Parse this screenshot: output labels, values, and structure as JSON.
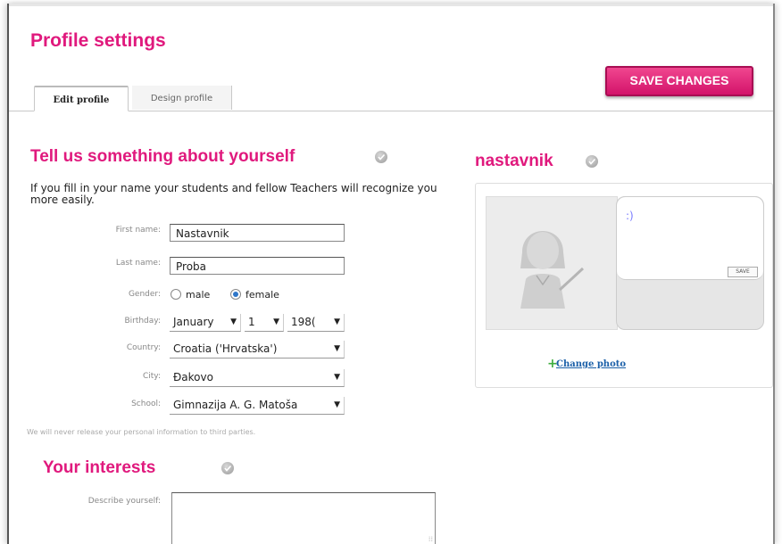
{
  "page": {
    "title": "Profile settings",
    "save_label": "SAVE CHANGES"
  },
  "tabs": [
    {
      "label": "Edit profile",
      "active": true
    },
    {
      "label": "Design profile",
      "active": false
    }
  ],
  "about": {
    "heading": "Tell us something about yourself",
    "intro": "If you fill in your name your students and fellow Teachers will recognize you more easily.",
    "first_name": {
      "label": "First name:",
      "value": "Nastavnik"
    },
    "last_name": {
      "label": "Last name:",
      "value": "Proba"
    },
    "gender": {
      "label": "Gender:",
      "options": [
        "male",
        "female"
      ],
      "selected": "female"
    },
    "birthday": {
      "label": "Birthday:",
      "month": "January",
      "day": "1",
      "year": "198("
    },
    "country": {
      "label": "Country:",
      "value": "Croatia ('Hrvatska')"
    },
    "city": {
      "label": "City:",
      "value": "Đakovo"
    },
    "school": {
      "label": "School:",
      "value": "Gimnazija A. G. Matoša"
    },
    "privacy_note": "We will never release your personal information to third parties."
  },
  "interests": {
    "heading": "Your interests",
    "describe_label": "Describe yourself:",
    "describe_value": ""
  },
  "profile_card": {
    "username": "nastavnik",
    "status_text": ":)",
    "status_save": "SAVE",
    "change_photo": "Change photo"
  },
  "colors": {
    "accent": "#e0197d",
    "link": "#1a5fa8",
    "plus": "#3fae3f"
  },
  "icons": {
    "verified": "check-icon",
    "dropdown": "chevron-down-icon",
    "add": "plus-icon",
    "avatar": "avatar-placeholder"
  }
}
